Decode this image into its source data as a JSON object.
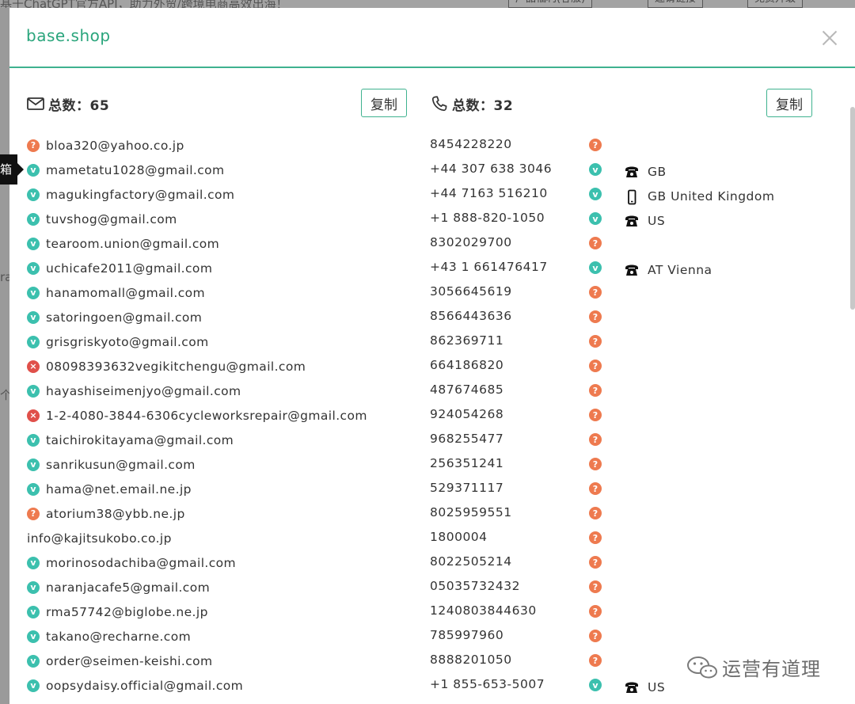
{
  "background": {
    "top_text": "基于ChatGPT官方API，助力外贸/跨境电商高效出海！",
    "top_buttons": [
      "产品福利(客服)",
      "邀请链接",
      "免费升级"
    ],
    "left_fragments": [
      "ra",
      "个"
    ],
    "tooltip": "箱"
  },
  "modal": {
    "title": "base.shop",
    "email": {
      "label": "总数：65",
      "copy": "复制",
      "items": [
        {
          "s": "q",
          "t": "bloa320@yahoo.co.jp"
        },
        {
          "s": "v",
          "t": "mametatu1028@gmail.com"
        },
        {
          "s": "v",
          "t": "magukingfactory@gmail.com"
        },
        {
          "s": "v",
          "t": "tuvshog@gmail.com"
        },
        {
          "s": "v",
          "t": "tearoom.union@gmail.com"
        },
        {
          "s": "v",
          "t": "uchicafe2011@gmail.com"
        },
        {
          "s": "v",
          "t": "hanamomall@gmail.com"
        },
        {
          "s": "v",
          "t": "satoringoen@gmail.com"
        },
        {
          "s": "v",
          "t": "grisgriskyoto@gmail.com"
        },
        {
          "s": "x",
          "t": "08098393632vegikitchengu@gmail.com"
        },
        {
          "s": "v",
          "t": "hayashiseimenjyo@gmail.com"
        },
        {
          "s": "x",
          "t": "1-2-4080-3844-6306cycleworksrepair@gmail.com"
        },
        {
          "s": "v",
          "t": "taichirokitayama@gmail.com"
        },
        {
          "s": "v",
          "t": "sanrikusun@gmail.com"
        },
        {
          "s": "v",
          "t": "hama@net.email.ne.jp"
        },
        {
          "s": "q",
          "t": "atorium38@ybb.ne.jp"
        },
        {
          "s": "none",
          "t": "info@kajitsukobo.co.jp"
        },
        {
          "s": "v",
          "t": "morinosodachiba@gmail.com"
        },
        {
          "s": "v",
          "t": "naranjacafe5@gmail.com"
        },
        {
          "s": "v",
          "t": "rma57742@biglobe.ne.jp"
        },
        {
          "s": "v",
          "t": "takano@recharne.com"
        },
        {
          "s": "v",
          "t": "order@seimen-keishi.com"
        },
        {
          "s": "v",
          "t": "oopsydaisy.official@gmail.com"
        }
      ]
    },
    "phone": {
      "label": "总数：32",
      "copy": "复制",
      "items": [
        {
          "n": "8454228220",
          "s": "q",
          "icon": "",
          "c": ""
        },
        {
          "n": "+44 307 638 3046",
          "s": "v",
          "icon": "landline-phone-icon",
          "c": "GB"
        },
        {
          "n": "+44 7163 516210",
          "s": "v",
          "icon": "mobile-phone-icon",
          "c": "GB United Kingdom"
        },
        {
          "n": "+1 888-820-1050",
          "s": "v",
          "icon": "landline-phone-icon",
          "c": "US"
        },
        {
          "n": "8302029700",
          "s": "q",
          "icon": "",
          "c": ""
        },
        {
          "n": "+43 1 661476417",
          "s": "v",
          "icon": "landline-phone-icon",
          "c": "AT Vienna"
        },
        {
          "n": "3056645619",
          "s": "q",
          "icon": "",
          "c": ""
        },
        {
          "n": "8566443636",
          "s": "q",
          "icon": "",
          "c": ""
        },
        {
          "n": "862369711",
          "s": "q",
          "icon": "",
          "c": ""
        },
        {
          "n": "664186820",
          "s": "q",
          "icon": "",
          "c": ""
        },
        {
          "n": "487674685",
          "s": "q",
          "icon": "",
          "c": ""
        },
        {
          "n": "924054268",
          "s": "q",
          "icon": "",
          "c": ""
        },
        {
          "n": "968255477",
          "s": "q",
          "icon": "",
          "c": ""
        },
        {
          "n": "256351241",
          "s": "q",
          "icon": "",
          "c": ""
        },
        {
          "n": "529371117",
          "s": "q",
          "icon": "",
          "c": ""
        },
        {
          "n": "8025959551",
          "s": "q",
          "icon": "",
          "c": ""
        },
        {
          "n": "1800004",
          "s": "q",
          "icon": "",
          "c": ""
        },
        {
          "n": "8022505214",
          "s": "q",
          "icon": "",
          "c": ""
        },
        {
          "n": "05035732432",
          "s": "q",
          "icon": "",
          "c": ""
        },
        {
          "n": "1240803844630",
          "s": "q",
          "icon": "",
          "c": ""
        },
        {
          "n": "785997960",
          "s": "q",
          "icon": "",
          "c": ""
        },
        {
          "n": "8888201050",
          "s": "q",
          "icon": "",
          "c": ""
        },
        {
          "n": "+1 855-653-5007",
          "s": "v",
          "icon": "landline-phone-icon",
          "c": "US"
        }
      ]
    },
    "badge_glyphs": {
      "v": "v",
      "q": "?",
      "x": "×"
    }
  },
  "watermark": {
    "text": "运营有道理",
    "icon": "wechat-icon"
  },
  "colors": {
    "accent": "#3fb28f",
    "title": "#2aa57c",
    "verified": "#3cc0ae",
    "unknown": "#ee7a4f",
    "invalid": "#e0504a"
  }
}
